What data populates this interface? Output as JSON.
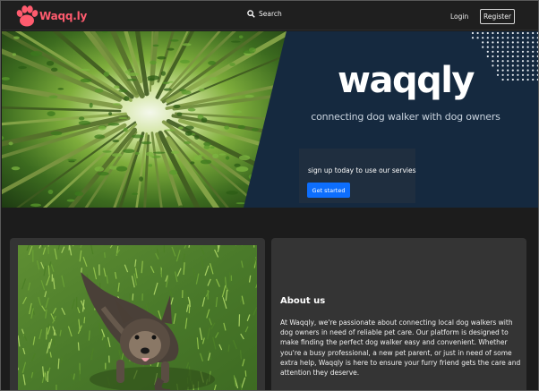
{
  "navbar": {
    "brand": "Waqq.ly",
    "search_label": "Search",
    "login_label": "Login",
    "register_label": "Register"
  },
  "hero": {
    "title": "waqqly",
    "subtitle": "connecting dog walker with dog owners",
    "cta_text": "sign up today to use our servies",
    "cta_button": "Get started"
  },
  "about": {
    "title": "About us",
    "body": "At Waqqly, we're passionate about connecting local dog walkers with dog owners in need of reliable pet care. Our platform is designed to make finding the perfect dog walker easy and convenient. Whether you're a busy professional, a new pet parent, or just in need of some extra help, Waqqly is here to ensure your furry friend gets the care and attention they deserve."
  },
  "colors": {
    "brand": "#ff5b6e",
    "hero_panel": "#15293f",
    "primary_button": "#0d6efd",
    "card": "#343434"
  }
}
